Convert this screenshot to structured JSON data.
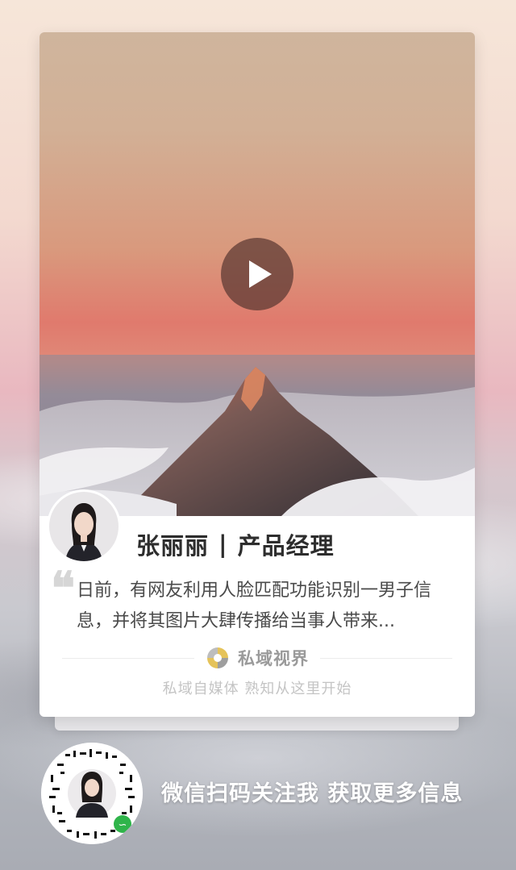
{
  "card": {
    "name": "张丽丽",
    "separator": "|",
    "title": "产品经理",
    "description": "日前，有网友利用人脸匹配功能识别一男子信息，并将其图片大肆传播给当事人带来...",
    "brand_name": "私域视界",
    "slogan": "私域自媒体  熟知从这里开始"
  },
  "qr": {
    "caption": "微信扫码关注我 获取更多信息"
  },
  "icons": [
    "play-icon",
    "quote-icon",
    "brand-logo-icon",
    "mini-program-icon"
  ]
}
